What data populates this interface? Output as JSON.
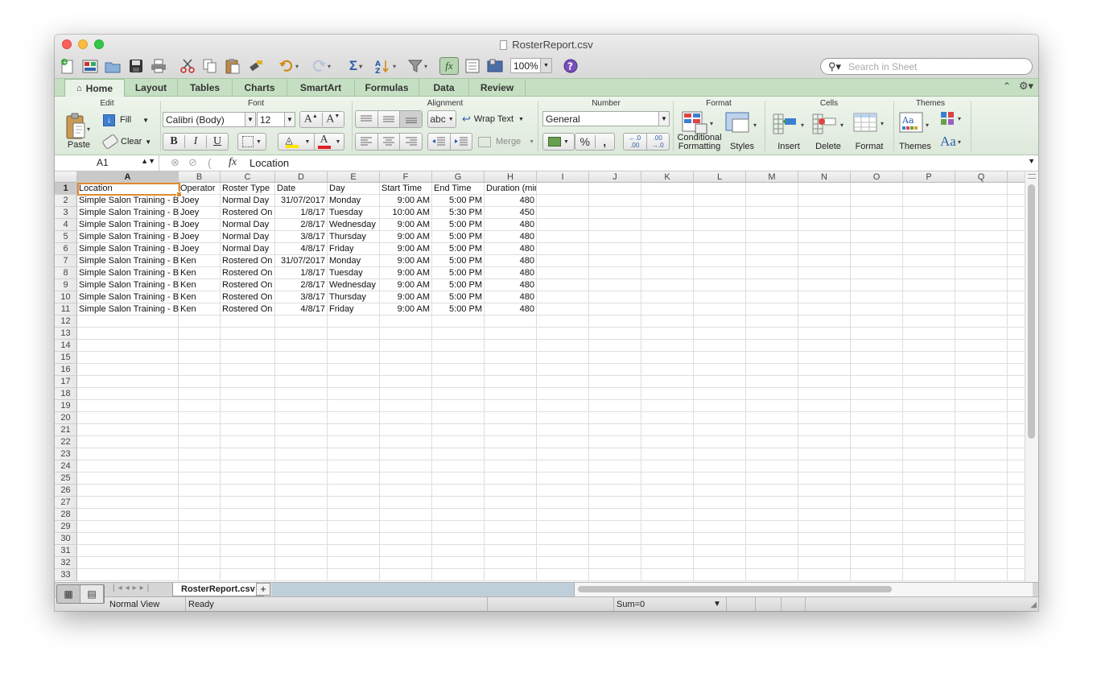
{
  "window": {
    "title": "RosterReport.csv"
  },
  "toolbar": {
    "zoom": "100%",
    "search_placeholder": "Search in Sheet"
  },
  "ribbon_tabs": [
    "Home",
    "Layout",
    "Tables",
    "Charts",
    "SmartArt",
    "Formulas",
    "Data",
    "Review"
  ],
  "ribbon": {
    "groups": {
      "edit": "Edit",
      "font": "Font",
      "alignment": "Alignment",
      "number": "Number",
      "format": "Format",
      "cells": "Cells",
      "themes": "Themes"
    },
    "paste": "Paste",
    "fill": "Fill",
    "clear": "Clear",
    "font_name": "Calibri (Body)",
    "font_size": "12",
    "bold": "B",
    "italic": "I",
    "underline": "U",
    "wrap_text": "Wrap Text",
    "merge": "Merge",
    "abc": "abc",
    "number_format": "General",
    "percent": "%",
    "comma": ",",
    "inc_decimal": "←.0\n.00",
    "dec_decimal": ".00\n→.0",
    "conditional_formatting": "Conditional Formatting",
    "styles": "Styles",
    "insert": "Insert",
    "delete": "Delete",
    "format": "Format",
    "themes": "Themes",
    "theme_fonts": "Aa"
  },
  "formula_bar": {
    "cell_ref": "A1",
    "fx": "fx",
    "content": "Location"
  },
  "sheet": {
    "columns": [
      "A",
      "B",
      "C",
      "D",
      "E",
      "F",
      "G",
      "H",
      "I",
      "J",
      "K",
      "L",
      "M",
      "N",
      "O",
      "P",
      "Q"
    ],
    "row_numbers": [
      "1",
      "2",
      "3",
      "4",
      "5",
      "6",
      "7",
      "8",
      "9",
      "10",
      "11",
      "12",
      "13",
      "14",
      "15",
      "16",
      "17",
      "18",
      "19",
      "20",
      "21",
      "22",
      "23",
      "24",
      "25",
      "26",
      "27",
      "28",
      "29",
      "30",
      "31",
      "32",
      "33"
    ],
    "rows": [
      [
        "Location",
        "Operator",
        "Roster Type",
        "Date",
        "Day",
        "Start Time",
        "End Time",
        "Duration (mins)"
      ],
      [
        "Simple Salon Training - B",
        "Joey",
        "Normal Day",
        "31/07/2017",
        "Monday",
        "9:00 AM",
        "5:00 PM",
        "480"
      ],
      [
        "Simple Salon Training - B",
        "Joey",
        "Rostered On",
        "1/8/17",
        "Tuesday",
        "10:00 AM",
        "5:30 PM",
        "450"
      ],
      [
        "Simple Salon Training - B",
        "Joey",
        "Normal Day",
        "2/8/17",
        "Wednesday",
        "9:00 AM",
        "5:00 PM",
        "480"
      ],
      [
        "Simple Salon Training - B",
        "Joey",
        "Normal Day",
        "3/8/17",
        "Thursday",
        "9:00 AM",
        "5:00 PM",
        "480"
      ],
      [
        "Simple Salon Training - B",
        "Joey",
        "Normal Day",
        "4/8/17",
        "Friday",
        "9:00 AM",
        "5:00 PM",
        "480"
      ],
      [
        "Simple Salon Training - B",
        "Ken",
        "Rostered On",
        "31/07/2017",
        "Monday",
        "9:00 AM",
        "5:00 PM",
        "480"
      ],
      [
        "Simple Salon Training - B",
        "Ken",
        "Rostered On",
        "1/8/17",
        "Tuesday",
        "9:00 AM",
        "5:00 PM",
        "480"
      ],
      [
        "Simple Salon Training - B",
        "Ken",
        "Rostered On",
        "2/8/17",
        "Wednesday",
        "9:00 AM",
        "5:00 PM",
        "480"
      ],
      [
        "Simple Salon Training - B",
        "Ken",
        "Rostered On",
        "3/8/17",
        "Thursday",
        "9:00 AM",
        "5:00 PM",
        "480"
      ],
      [
        "Simple Salon Training - B",
        "Ken",
        "Rostered On",
        "4/8/17",
        "Friday",
        "9:00 AM",
        "5:00 PM",
        "480"
      ]
    ],
    "selected_cell": "A1",
    "tab_name": "RosterReport.csv",
    "add_tab": "+"
  },
  "status": {
    "view": "Normal View",
    "state": "Ready",
    "sum": "Sum=0"
  },
  "colors": {
    "ribbon_green": "#c5dfc2",
    "selection": "#e08a2c",
    "close": "#fc605c",
    "minimize": "#fdbc40",
    "zoom": "#34c84a"
  },
  "icons": [
    "new-workbook-icon",
    "template-gallery-icon",
    "open-icon",
    "save-icon",
    "print-icon",
    "cut-icon",
    "copy-icon",
    "paste-icon",
    "format-painter-icon",
    "undo-icon",
    "redo-icon",
    "autosum-icon",
    "sort-icon",
    "filter-icon",
    "formula-builder-icon",
    "toolbox-icon",
    "media-browser-icon",
    "help-icon",
    "search-icon"
  ]
}
